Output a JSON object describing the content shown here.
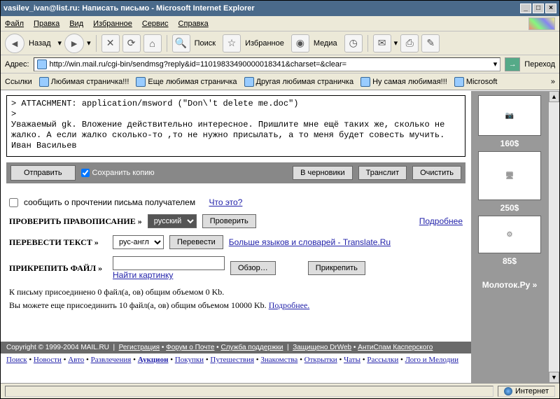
{
  "title": "vasilev_ivan@list.ru: Написать письмо - Microsoft Internet Explorer",
  "menu": {
    "file": "Файл",
    "edit": "Правка",
    "view": "Вид",
    "favorites": "Избранное",
    "tools": "Сервис",
    "help": "Справка"
  },
  "toolbar": {
    "back": "Назад",
    "search": "Поиск",
    "favorites": "Избранное",
    "media": "Медиа"
  },
  "address": {
    "label": "Адрес:",
    "url": "http://win.mail.ru/cgi-bin/sendmsg?reply&id=11019833490000018341&charset=&clear=",
    "go": "Переход"
  },
  "links": {
    "label": "Ссылки",
    "l1": "Любимая страничка!!!",
    "l2": "Еще любимая страничка",
    "l3": "Другая любимая страничка",
    "l4": "Ну самая любимая!!!",
    "l5": "Microsoft"
  },
  "msg": "> ATTACHMENT: application/msword (\"Don\\'t delete me.doc\")\n>\nУважаемый gk. Вложение действительно интересное. Пришлите мне ещё таких же, сколько не жалко. А если жалко сколько-то ,то не нужно присылать, а то меня будет совесть мучить.\nИван Васильев",
  "buttons": {
    "send": "Отправить",
    "savecopy": "Сохранить копию",
    "drafts": "В черновики",
    "translit": "Транслит",
    "clear": "Очистить"
  },
  "notify": {
    "label": "сообщить о прочтении письма получателем",
    "what": "Что это?"
  },
  "spell": {
    "label": "Проверить правописание »",
    "lang": "русский",
    "btn": "Проверить",
    "more": "Подробнее"
  },
  "trans": {
    "label": "Перевести текст »",
    "pair": "рус-англ",
    "btn": "Перевести",
    "more": "Больше языков и словарей - Translate.Ru"
  },
  "attach": {
    "label": "Прикрепить файл »",
    "browse": "Обзор…",
    "btn": "Прикрепить",
    "find": "Найти картинку"
  },
  "attinfo": {
    "l1": "К письму присоединено 0 файл(а, ов) общим объемом 0 Kb.",
    "l2": "Вы можете еще присоединить 10 файл(а, ов) общим объемом 10000 Kb. ",
    "more": "Подробнее."
  },
  "ads": {
    "p1": "160$",
    "p2": "250$",
    "p3": "85$",
    "brand": "Молоток.Ру »"
  },
  "footer1": {
    "copy": "Copyright © 1999-2004 MAIL.RU",
    "reg": "Регистрация",
    "forum": "Форум о Почте",
    "support": "Служба поддержки",
    "drweb": "Защищено DrWeb",
    "kasp": "АнтиСпам Касперского"
  },
  "footer2": [
    "Поиск",
    "Новости",
    "Авто",
    "Развлечения",
    "Аукцион",
    "Покупки",
    "Путешествия",
    "Знакомства",
    "Открытки",
    "Чаты",
    "Рассылки",
    "Лого и Мелодии"
  ],
  "status": {
    "zone": "Интернет"
  }
}
